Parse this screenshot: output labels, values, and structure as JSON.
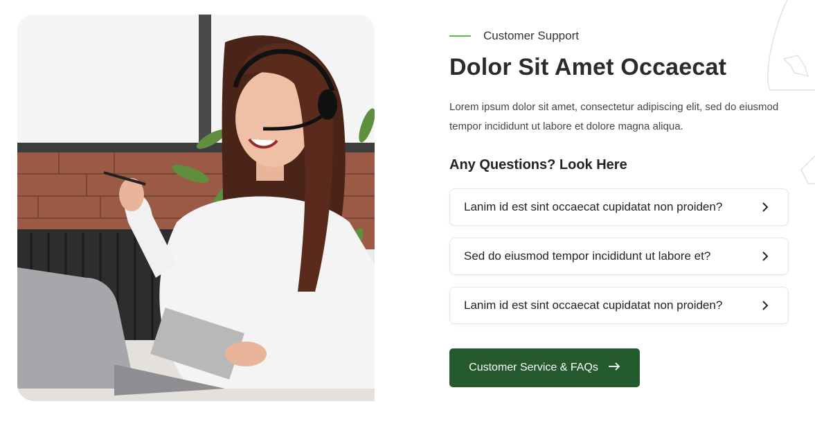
{
  "section": {
    "eyebrow": "Customer Support",
    "title": "Dolor Sit Amet Occaecat",
    "description": "Lorem ipsum dolor sit amet, consectetur adipiscing elit, sed do eiusmod tempor incididunt ut labore et dolore magna aliqua.",
    "questions_heading": "Any Questions? Look Here",
    "faqs": [
      {
        "label": "Lanim id est sint occaecat cupidatat non proiden?",
        "icon": "chevron-right-icon"
      },
      {
        "label": "Sed do eiusmod tempor incididunt ut labore et?",
        "icon": "chevron-right-icon"
      },
      {
        "label": "Lanim id est sint occaecat cupidatat non proiden?",
        "icon": "chevron-right-icon"
      }
    ],
    "cta_label": "Customer Service & FAQs",
    "cta_icon": "arrow-right-icon"
  },
  "colors": {
    "accent_green": "#5cb848",
    "button_green": "#245a2e",
    "heading": "#2b2b2b"
  },
  "image": {
    "subject": "support-agent-photo"
  }
}
